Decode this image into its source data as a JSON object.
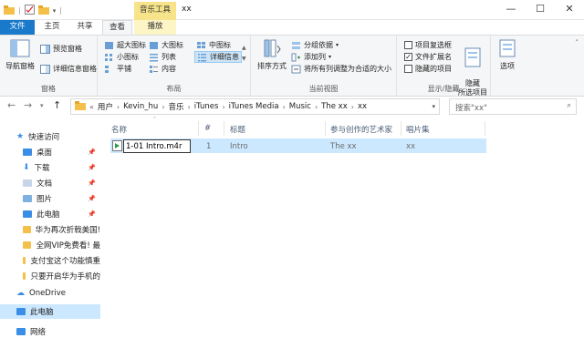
{
  "titlebar": {
    "contextual_tab": "音乐工具",
    "title": "xx",
    "minimize": "—",
    "maximize": "☐",
    "close": "✕"
  },
  "tabs": {
    "file": "文件",
    "home": "主页",
    "share": "共享",
    "view": "查看",
    "play": "播放"
  },
  "ribbon": {
    "pane": {
      "nav_pane": "导航窗格",
      "preview": "预览窗格",
      "details": "详细信息窗格",
      "label": "窗格"
    },
    "layout": {
      "xl_icons": "超大图标",
      "large_icons": "大图标",
      "medium_icons": "中图标",
      "small_icons": "小图标",
      "list": "列表",
      "details": "详细信息",
      "tiles": "平铺",
      "content": "内容",
      "label": "布局"
    },
    "current_view": {
      "sort_by": "排序方式",
      "group_by": "分组依据",
      "add_columns": "添加列",
      "size_all_columns": "将所有列调整为合适的大小",
      "label": "当前视图"
    },
    "show_hide": {
      "item_checkboxes": "项目复选框",
      "file_extensions": "文件扩展名",
      "hidden_items": "隐藏的项目",
      "hide_selected": "隐藏\n所选项目",
      "label": "显示/隐藏",
      "item_checkboxes_checked": false,
      "file_extensions_checked": true,
      "hidden_items_checked": false
    },
    "options": "选项"
  },
  "address": {
    "overflow": "«",
    "crumbs": [
      "用户",
      "Kevin_hu",
      "音乐",
      "iTunes",
      "iTunes Media",
      "Music",
      "The xx",
      "xx"
    ],
    "refresh": "↻",
    "search_placeholder": "搜索\"xx\""
  },
  "nav": {
    "quick_access": "快速访问",
    "items": [
      {
        "label": "桌面",
        "pinned": true
      },
      {
        "label": "下载",
        "pinned": true
      },
      {
        "label": "文档",
        "pinned": true
      },
      {
        "label": "图片",
        "pinned": true
      },
      {
        "label": "此电脑",
        "pinned": true
      },
      {
        "label": "华为再次折戟美国!",
        "pinned": false
      },
      {
        "label": "全网VIP免费看! 最",
        "pinned": false
      },
      {
        "label": "支付宝这个功能慎重",
        "pinned": false
      },
      {
        "label": "只要开启华为手机的",
        "pinned": false
      }
    ],
    "onedrive": "OneDrive",
    "this_pc": "此电脑",
    "network": "网络"
  },
  "file_list": {
    "columns": {
      "name": "名称",
      "number": "#",
      "title": "标题",
      "artists": "参与创作的艺术家",
      "album": "唱片集"
    },
    "rows": [
      {
        "name_edit": "1-01 Intro.m4r",
        "number": "1",
        "title": "Intro",
        "artist": "The xx",
        "album": "xx"
      }
    ]
  },
  "colors": {
    "file_tab": "#1979ca",
    "context_tab": "#f7e48a",
    "selection": "#cce8ff"
  }
}
